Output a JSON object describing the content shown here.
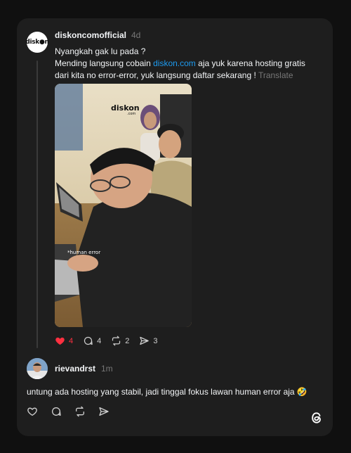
{
  "post": {
    "username": "diskoncomofficial",
    "time": "4d",
    "avatar_text": "disk●n",
    "line1": "Nyangkah gak lu pada ?",
    "line2_before": "Mending langsung cobain ",
    "line2_link": "diskon.com",
    "line2_after": " aja yuk karena hosting gratis",
    "line3": "dari kita no error-error, yuk langsung daftar sekarang ! ",
    "translate": "Translate",
    "media": {
      "logo_text": "diskon",
      "logo_sub": ".com",
      "caption": "*human error"
    },
    "likes": "4",
    "replies": "4",
    "reposts": "2",
    "shares": "3",
    "like_color": "#ff3040"
  },
  "reply": {
    "username": "rievandrst",
    "time": "1m",
    "text": "untung ada hosting yang stabil, jadi tinggal fokus lawan human error aja 🤣"
  },
  "colors": {
    "background": "#101010",
    "card": "#1e1e1e",
    "link": "#1d9bf0",
    "muted": "#777777"
  }
}
